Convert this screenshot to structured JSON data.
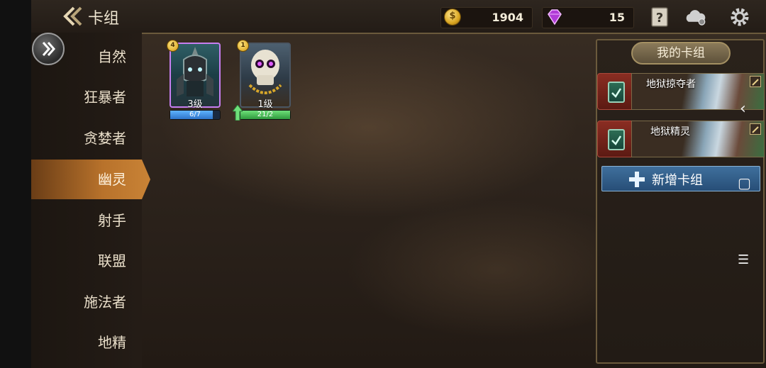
{
  "header": {
    "title": "卡组",
    "gold": "1904",
    "gems": "15"
  },
  "sidebar": {
    "items": [
      {
        "label": "自然"
      },
      {
        "label": "狂暴者"
      },
      {
        "label": "贪婪者"
      },
      {
        "label": "幽灵",
        "active": true
      },
      {
        "label": "射手"
      },
      {
        "label": "联盟"
      },
      {
        "label": "施法者"
      },
      {
        "label": "地精"
      }
    ]
  },
  "cards": [
    {
      "cost": "4",
      "level": "3级",
      "progress": "6/7",
      "progress_fraction": 0.86,
      "rarity_color": "#b26ad9"
    },
    {
      "cost": "1",
      "level": "1级",
      "progress": "21/2",
      "progress_fraction": 1.0,
      "rarity_color": "#5a6a7a",
      "upgradable": true
    }
  ],
  "panel": {
    "title": "我的卡组",
    "decks": [
      {
        "name": "地狱掠夺者"
      },
      {
        "name": "地狱精灵"
      }
    ],
    "add_label": "新增卡组"
  },
  "system_nav": {
    "back": "‹",
    "home": "▢",
    "menu": "☰"
  },
  "colors": {
    "accent": "#c98336",
    "add_button": "#3f6f9c",
    "gold": "#d9a521",
    "gem": "#b03ad6"
  }
}
